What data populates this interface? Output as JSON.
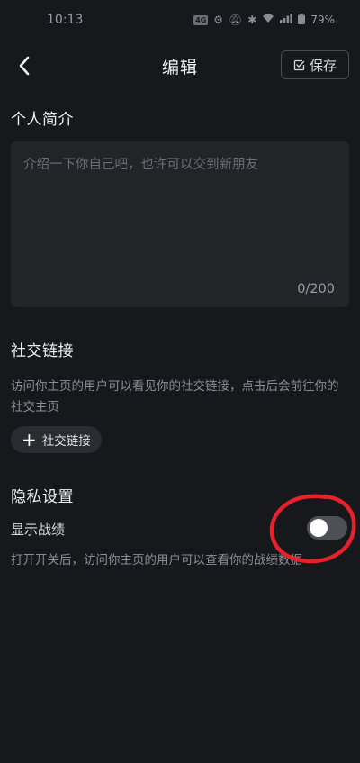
{
  "status_bar": {
    "time": "10:13",
    "network_badge": "4G",
    "battery": "79%"
  },
  "header": {
    "title": "编辑",
    "save_label": "保存"
  },
  "bio": {
    "title": "个人简介",
    "placeholder": "介绍一下你自己吧，也许可以交到新朋友",
    "value": "",
    "counter": "0/200"
  },
  "social": {
    "title": "社交链接",
    "description": "访问你主页的用户可以看见你的社交链接，点击后会前往你的社交主页",
    "add_label": "社交链接"
  },
  "privacy": {
    "title": "隐私设置",
    "show_record_label": "显示战绩",
    "show_record_enabled": false,
    "show_record_hint": "打开开关后，访问你主页的用户可以查看你的战绩数据"
  },
  "colors": {
    "background": "#16181c",
    "panel": "#222428",
    "annotation": "#e5222a"
  }
}
